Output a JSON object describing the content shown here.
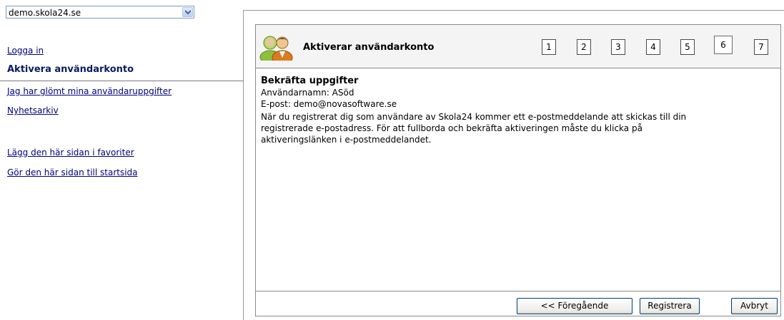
{
  "site_selector": {
    "value": "demo.skola24.se"
  },
  "nav": {
    "login": "Logga in",
    "activate": "Aktivera användarkonto",
    "forgot": "Jag har glömt mina användaruppgifter",
    "news": "Nyhetsarkiv",
    "favorites": "Lägg den här sidan i favoriter",
    "startpage": "Gör den här sidan till startsida"
  },
  "wizard": {
    "title": "Aktiverar användarkonto",
    "steps": [
      "1",
      "2",
      "3",
      "4",
      "5",
      "6",
      "7"
    ],
    "active_step": 6,
    "heading": "Bekräfta uppgifter",
    "username_line": "Användarnamn:  ASöd",
    "email_line": "E-post:  demo@novasoftware.se",
    "body_1": "När du registrerat dig som användare av Skola24 kommer ett e-postmeddelande att skickas till din",
    "body_2": "registrerade e-postadress. För att fullborda och bekräfta aktiveringen måste du klicka på",
    "body_3": "aktiveringslänken i e-postmeddelandet.",
    "prev_button": "<< Föregående",
    "register_button": "Registrera",
    "cancel_button": "Avbryt"
  },
  "colors": {
    "link": "#000080",
    "current": "#0b1a63",
    "header_bg": "#f4f4f4"
  }
}
